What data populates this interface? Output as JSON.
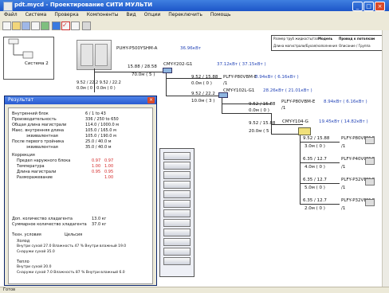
{
  "window": {
    "title": "pdt.mycd - Проектирование СИТИ МУЛЬТИ"
  },
  "menu": [
    "Файл",
    "Система",
    "Проверка",
    "Компоненты",
    "Вид",
    "Опции",
    "Переключить",
    "Помощь"
  ],
  "tree": {
    "system_label": "Система 2"
  },
  "outdoor": {
    "model": "PUHY-P500YSHM-A",
    "capacity": "36.96кВт"
  },
  "header_table": {
    "c1": "Размер труб жидкость/газ",
    "c2": "Модель",
    "c3": "Провод к потолкам",
    "c4": "Длина магистрали/Бухая/наполнения",
    "c5": "Описание / Группа"
  },
  "diagram": {
    "pipe_main": "15.88 / 28.58",
    "len_main": "70.0м ( 5 )",
    "pipe_out": "9.52 / 22.2  9.52 / 22.2",
    "len_out": "0.0м ( 0 )  0.0м ( 0 )",
    "joint1": "CMY-Y202-G1",
    "joint1_cap": "37.12кВт ( 37.15кВт )",
    "pipe_b1": "9.52 / 15.88",
    "len_b1": "0.0м ( 0 )",
    "unit1": "PLFY-P80VBM-E",
    "unit1_cap": "8.94кВт ( 6.16кВт )",
    "unit1_idx": "/1",
    "pipe_b2": "9.52 / 22.2",
    "len_b2": "10.0м ( 3 )",
    "joint2": "CMY-Y102L-G1",
    "joint2_cap": "28.26кВт ( 21.01кВт )",
    "pipe_b3": "9.52 / 15.88",
    "len_b3": "0.0м ( 0 )",
    "unit2": "PLFY-P80VBM-E",
    "unit2_cap": "8.94кВт ( 6.16кВт )",
    "unit2_idx": "/1",
    "pipe_b4": "9.52 / 15.88",
    "len_b4": "20.0м ( 5 )",
    "joint3": "CMY-Y104-G",
    "joint3_cap": "19.45кВт ( 14.82кВт )",
    "branches": [
      {
        "pipe": "9.52 / 15.88",
        "len": "3.0м ( 0 )",
        "model": "PLFY-P80VBM-E",
        "idx": "/1"
      },
      {
        "pipe": "6.35 / 12.7",
        "len": "4.0м ( 0 )",
        "model": "PLFY-P40VCM-E",
        "idx": "/1"
      },
      {
        "pipe": "6.35 / 12.7",
        "len": "5.0м ( 0 )",
        "model": "PLFY-P32VBM-E",
        "idx": "/1"
      },
      {
        "pipe": "6.35 / 12.7",
        "len": "2.0м ( 0 )",
        "model": "PLFY-P32VBM-E",
        "idx": "/1"
      }
    ]
  },
  "dialog": {
    "title": "Результат",
    "rows": [
      {
        "label": "Внутренний блок",
        "value": "6 / 1 to 43"
      },
      {
        "label": "Производительность",
        "value": "336  /  250 to 650"
      },
      {
        "label": "Общая длина магистрали",
        "value": "114.0 / 1000.0  м"
      },
      {
        "label": "Макс. внутренняя длина",
        "value": "105.0 / 165.0  м"
      },
      {
        "label": "эквивалентная",
        "value": "105.0 / 190.0  м"
      },
      {
        "label": "После первого тройника",
        "value": "25.0 / 40.0  м"
      },
      {
        "label": "эквивалентная",
        "value": "35.0 / 40.0  м"
      }
    ],
    "correction_label": "Коррекция",
    "corrections": [
      {
        "label": "Предел наружного блока",
        "v1": "0.97",
        "v2": "0.97"
      },
      {
        "label": "Температура",
        "v1": "1.00",
        "v2": "1.00"
      },
      {
        "label": "Длина магистрали",
        "v1": "0.95",
        "v2": "0.95"
      },
      {
        "label": "Разморажевание",
        "v1": "",
        "v2": "1.00"
      }
    ],
    "refrig_add": "Доп. количество хладагента",
    "refrig_add_val": "13.0  кг",
    "refrig_total": "Суммарное количество хладагента",
    "refrig_total_val": "37.0  кг",
    "cond_label": "Техн. условия",
    "cond_unit": "Цельсия",
    "cool_label": "Холод",
    "cool_l1": "Внутри сухой    27.0 Влажность   47 %  Внутри влажный   19.0",
    "cool_l2": "Снаружи сухой   35.0",
    "heat_label": "Тепло",
    "heat_l1": "Внутри сухой    20.0",
    "heat_l2": "Снаружи сухой    7.0 Влажность   87 %  Внутри влажный   6.0"
  },
  "status": {
    "text": "Готов"
  },
  "colors": {
    "accent": "#2a5bd0",
    "blue_text": "#2646b8",
    "red_text": "#d42828"
  }
}
